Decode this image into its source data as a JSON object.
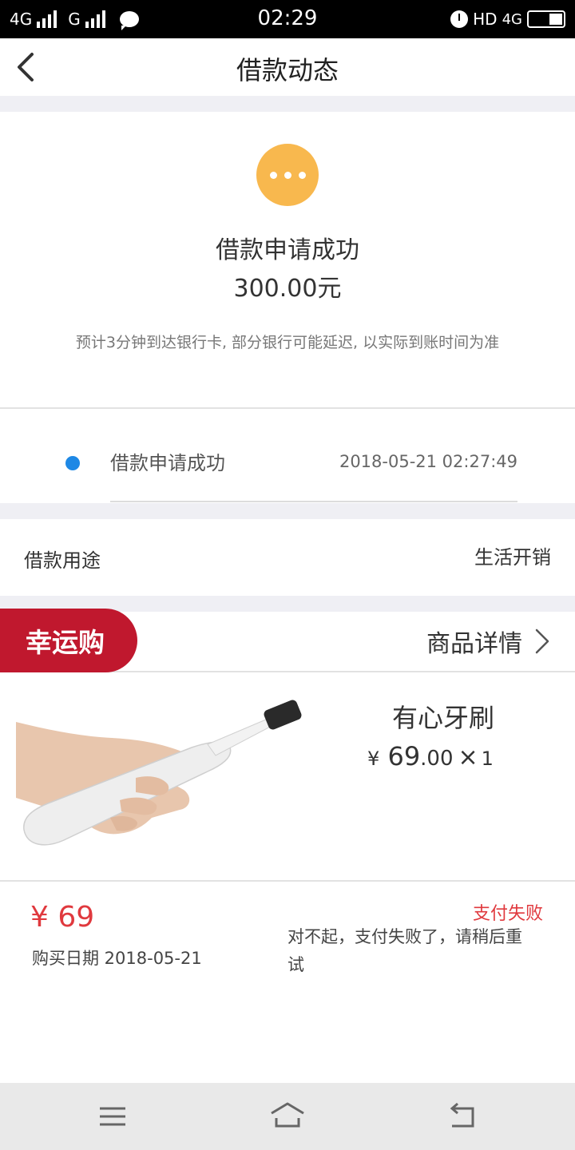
{
  "status_bar": {
    "network_1": "4G",
    "network_2": "G",
    "time": "02:29",
    "hd": "HD",
    "network_3": "4G",
    "colors": {
      "background": "#000000",
      "text": "#ffffff"
    }
  },
  "header": {
    "title": "借款动态",
    "back_icon": "chevron-left-icon"
  },
  "loan_status": {
    "icon": "ellipsis-pending-icon",
    "title": "借款申请成功",
    "amount": "300.00元",
    "note": "预计3分钟到达银行卡, 部分银行可能延迟, 以实际到账时间为准",
    "colors": {
      "pending_icon": "#f8b84e"
    }
  },
  "timeline": {
    "items": [
      {
        "label": "借款申请成功",
        "time": "2018-05-21 02:27:49",
        "dot_color": "#1e88e5"
      }
    ]
  },
  "purpose": {
    "label": "借款用途",
    "value": "生活开销"
  },
  "product": {
    "badge": "幸运购",
    "detail_link": "商品详情",
    "name": "有心牙刷",
    "price_symbol": "¥",
    "price_int": "69",
    "price_dec": ".00",
    "times": "×",
    "quantity": "1",
    "paid_amount": "¥ 69",
    "purchase_date": "购买日期 2018-05-21",
    "pay_status": "支付失败",
    "pay_message": "对不起，支付失败了，请稍后重试",
    "colors": {
      "badge": "#c0182e",
      "accent_red": "#e0393e"
    }
  },
  "nav_bar": {
    "menu_icon": "menu-icon",
    "home_icon": "home-icon",
    "back_icon": "return-icon"
  }
}
